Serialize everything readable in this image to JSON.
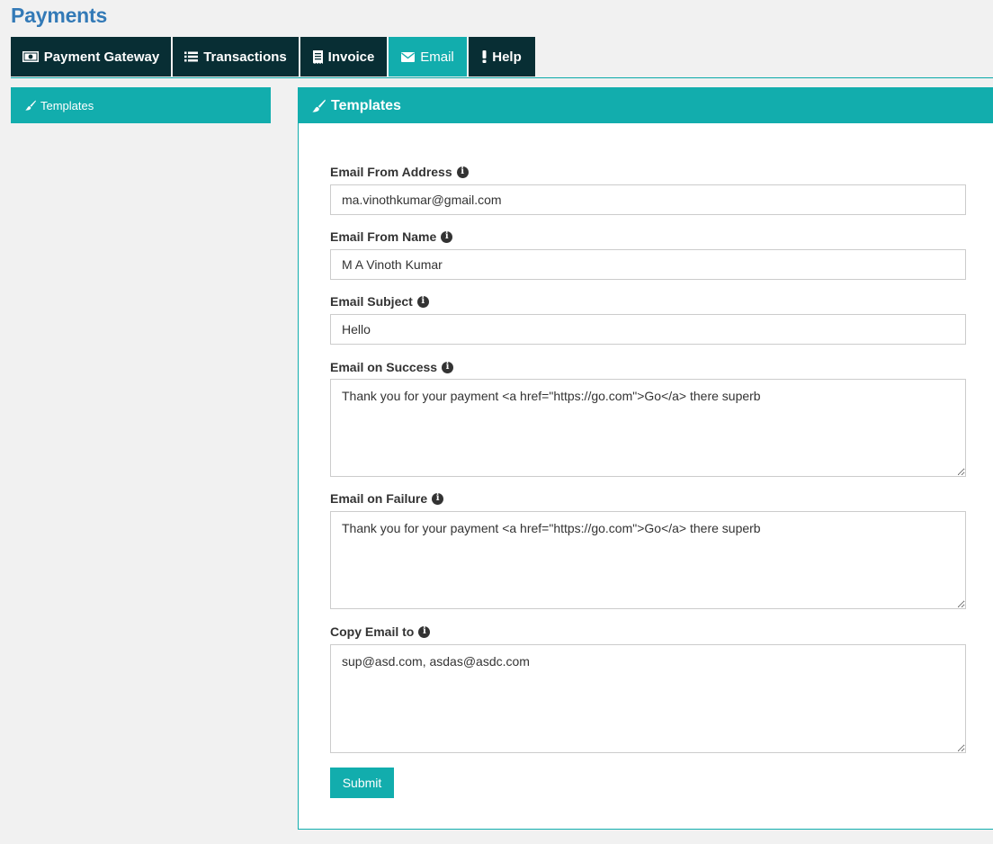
{
  "page": {
    "title": "Payments"
  },
  "tabs": [
    {
      "label": "Payment Gateway",
      "icon": "money-icon",
      "active": false
    },
    {
      "label": "Transactions",
      "icon": "list-icon",
      "active": false
    },
    {
      "label": "Invoice",
      "icon": "receipt-icon",
      "active": false
    },
    {
      "label": "Email",
      "icon": "envelope-icon",
      "active": true
    },
    {
      "label": "Help",
      "icon": "exclamation-icon",
      "active": false
    }
  ],
  "sidebar": {
    "items": [
      {
        "label": "Templates",
        "icon": "paintbrush-icon"
      }
    ]
  },
  "panel": {
    "title": "Templates",
    "icon": "paintbrush-icon",
    "fields": {
      "from_address": {
        "label": "Email From Address",
        "value": "ma.vinothkumar@gmail.com"
      },
      "from_name": {
        "label": "Email From Name",
        "value": "M A Vinoth Kumar"
      },
      "subject": {
        "label": "Email Subject",
        "value": "Hello"
      },
      "on_success": {
        "label": "Email on Success",
        "value": "Thank you for your payment <a href=\"https://go.com\">Go</a> there superb"
      },
      "on_failure": {
        "label": "Email on Failure",
        "value": "Thank you for your payment <a href=\"https://go.com\">Go</a> there superb"
      },
      "copy_to": {
        "label": "Copy Email to",
        "value": "sup@asd.com, asdas@asdc.com"
      }
    },
    "submit_label": "Submit"
  },
  "colors": {
    "accent": "#12adad",
    "tab_dark": "#082e34",
    "title_blue": "#337ab7"
  }
}
